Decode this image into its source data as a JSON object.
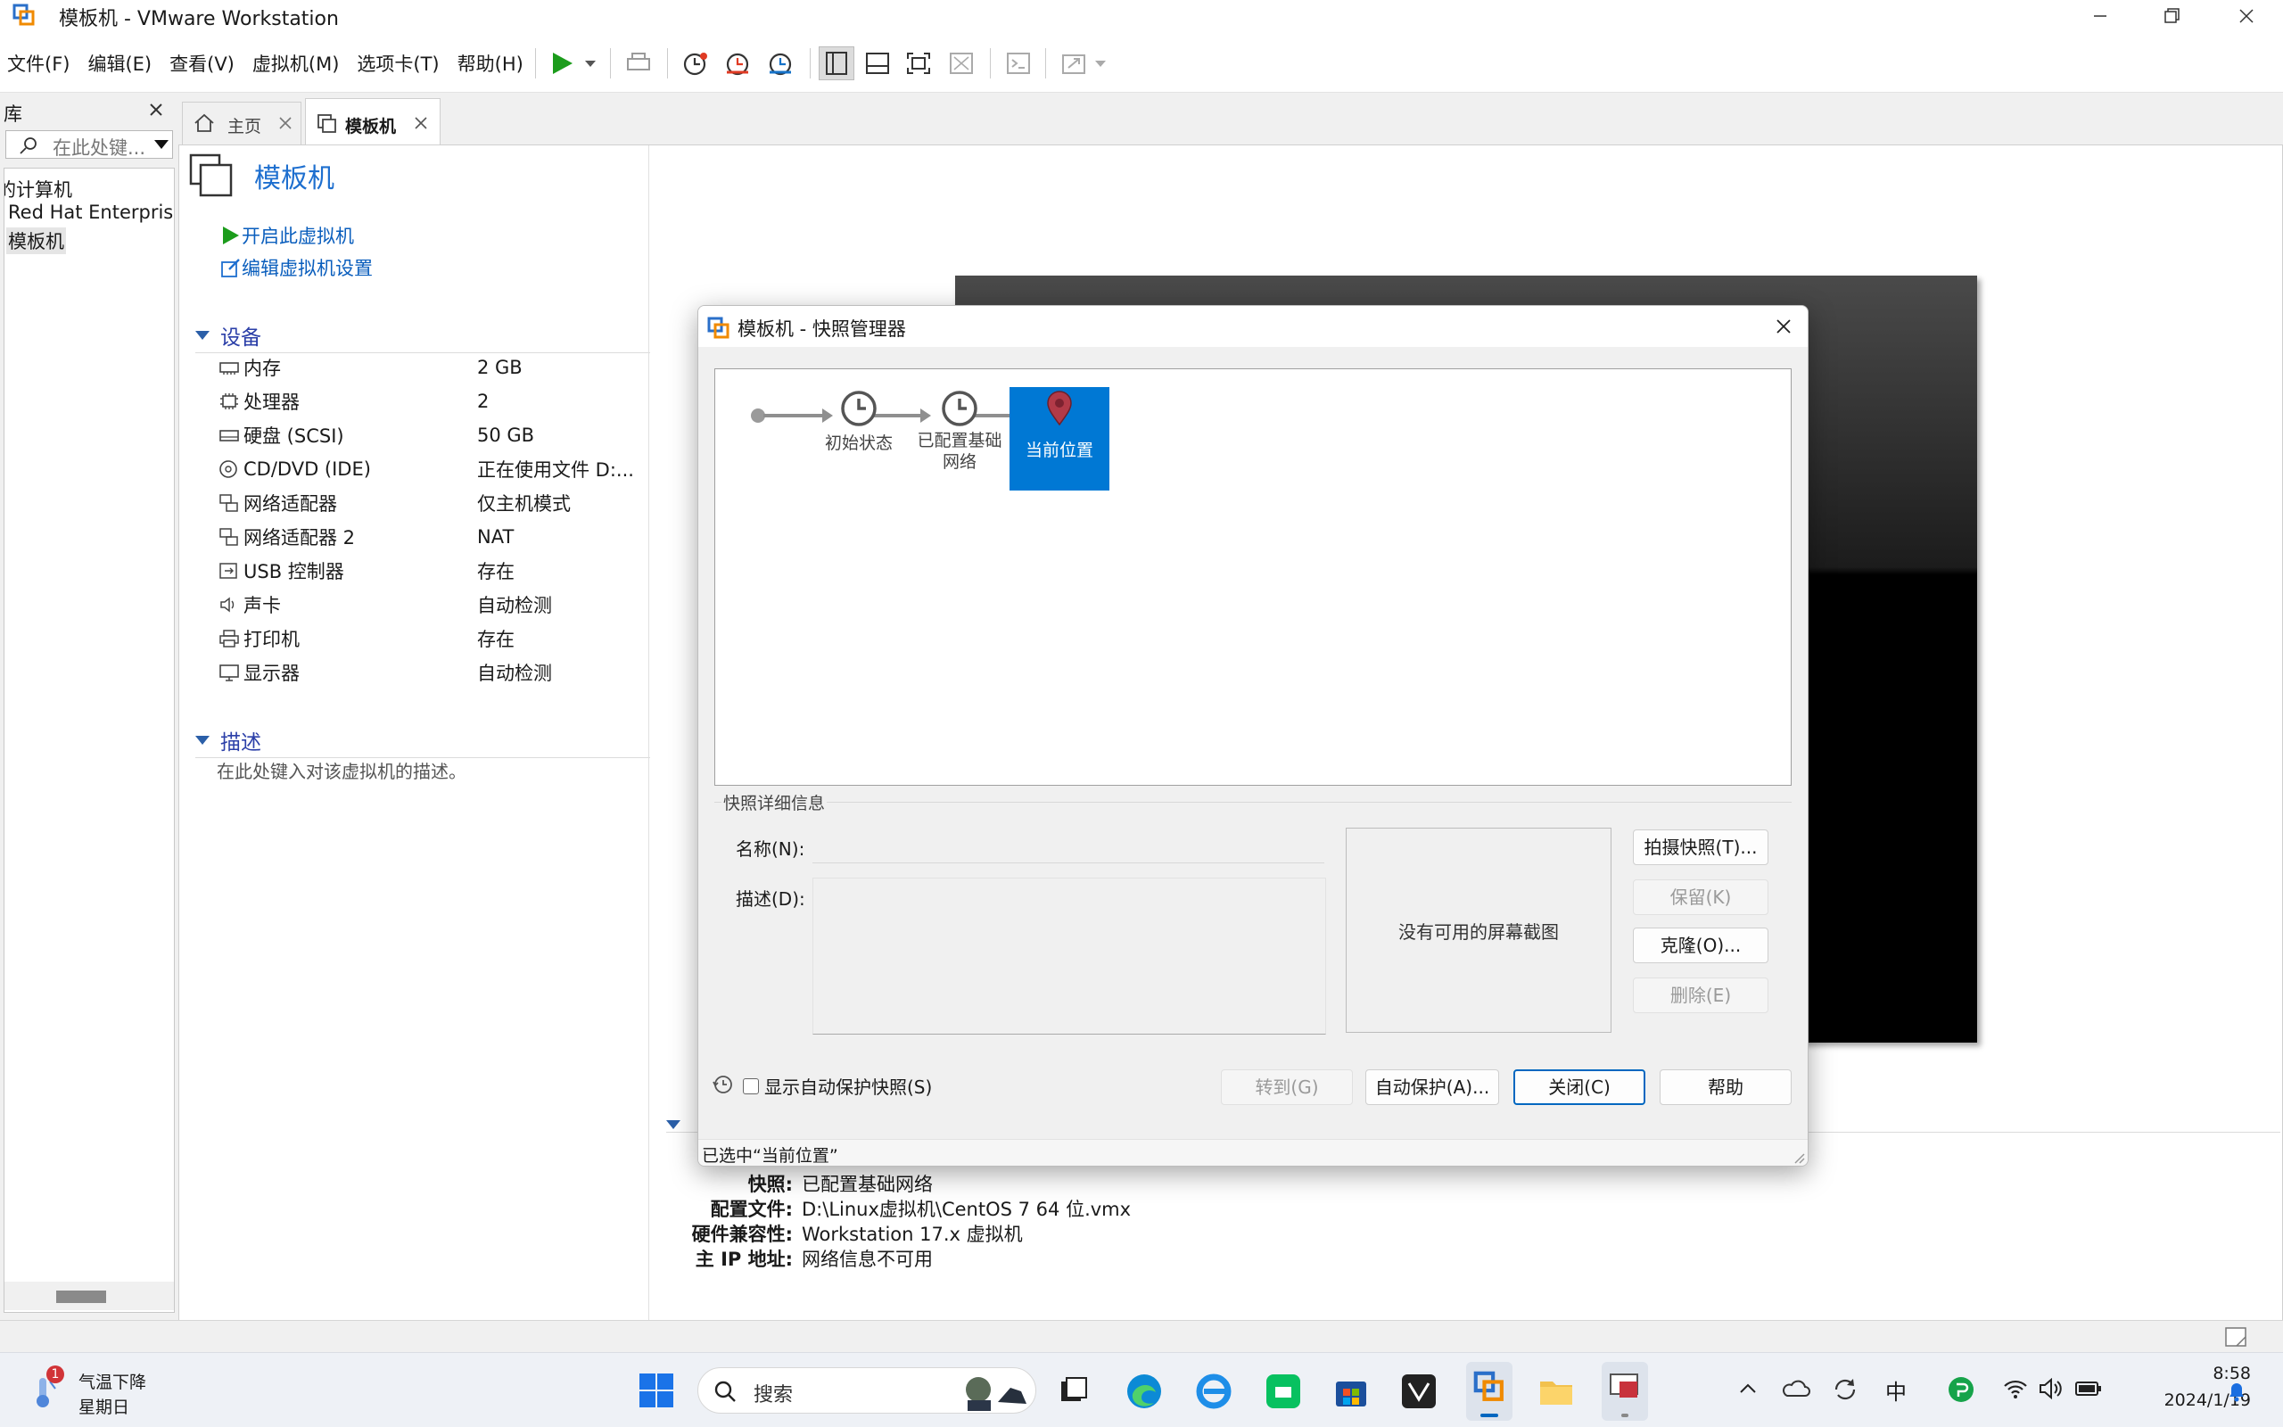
{
  "window": {
    "title": "模板机 - VMware Workstation"
  },
  "menubar": {
    "items": [
      "文件(F)",
      "编辑(E)",
      "查看(V)",
      "虚拟机(M)",
      "选项卡(T)",
      "帮助(H)"
    ]
  },
  "library": {
    "title": "库",
    "search_placeholder": "在此处键...",
    "tree": [
      "的计算机",
      "Red Hat Enterprise",
      "模板机"
    ]
  },
  "tabs": [
    {
      "label": "主页"
    },
    {
      "label": "模板机"
    }
  ],
  "vm": {
    "title": "模板机",
    "actions": {
      "power_on": "开启此虚拟机",
      "edit_settings": "编辑虚拟机设置"
    },
    "devices_header": "设备",
    "devices": [
      {
        "icon": "memory-icon",
        "name": "内存",
        "value": "2 GB"
      },
      {
        "icon": "cpu-icon",
        "name": "处理器",
        "value": "2"
      },
      {
        "icon": "hard-disk-icon",
        "name": "硬盘 (SCSI)",
        "value": "50 GB"
      },
      {
        "icon": "cd-dvd-icon",
        "name": "CD/DVD (IDE)",
        "value": "正在使用文件 D:..."
      },
      {
        "icon": "network-adapter-icon",
        "name": "网络适配器",
        "value": "仅主机模式"
      },
      {
        "icon": "network-adapter-icon",
        "name": "网络适配器 2",
        "value": "NAT"
      },
      {
        "icon": "usb-icon",
        "name": "USB 控制器",
        "value": "存在"
      },
      {
        "icon": "sound-icon",
        "name": "声卡",
        "value": "自动检测"
      },
      {
        "icon": "printer-icon",
        "name": "打印机",
        "value": "存在"
      },
      {
        "icon": "display-icon",
        "name": "显示器",
        "value": "自动检测"
      }
    ],
    "description_header": "描述",
    "description_placeholder": "在此处键入对该虚拟机的描述。",
    "details": [
      {
        "label": "快照:",
        "value": "已配置基础网络"
      },
      {
        "label": "配置文件:",
        "value": "D:\\Linux虚拟机\\CentOS 7 64 位.vmx"
      },
      {
        "label": "硬件兼容性:",
        "value": "Workstation 17.x 虚拟机"
      },
      {
        "label": "主 IP 地址:",
        "value": "网络信息不可用"
      }
    ]
  },
  "dialog": {
    "title": "模板机 - 快照管理器",
    "nodes": [
      {
        "label": "初始状态"
      },
      {
        "label": "已配置基础网络"
      },
      {
        "label": "当前位置"
      }
    ],
    "details_group": "快照详细信息",
    "name_label": "名称(N):",
    "desc_label": "描述(D):",
    "no_screenshot": "没有可用的屏幕截图",
    "buttons": {
      "take": "拍摄快照(T)...",
      "keep": "保留(K)",
      "clone": "克隆(O)...",
      "delete": "删除(E)",
      "goto": "转到(G)",
      "autoprotect": "自动保护(A)...",
      "close": "关闭(C)",
      "help": "帮助"
    },
    "show_autoprotect": "显示自动保护快照(S)",
    "status": "已选中“当前位置”"
  },
  "taskbar": {
    "weather": {
      "badge": "1",
      "line1": "气温下降",
      "line2": "星期日"
    },
    "search": "搜索",
    "ime": "中",
    "time": "8:58",
    "date": "2024/1/19"
  },
  "colors": {
    "accent": "#0078d4",
    "link": "#0a5ebd",
    "section": "#2b3fa8",
    "play": "#1c9c1c"
  }
}
